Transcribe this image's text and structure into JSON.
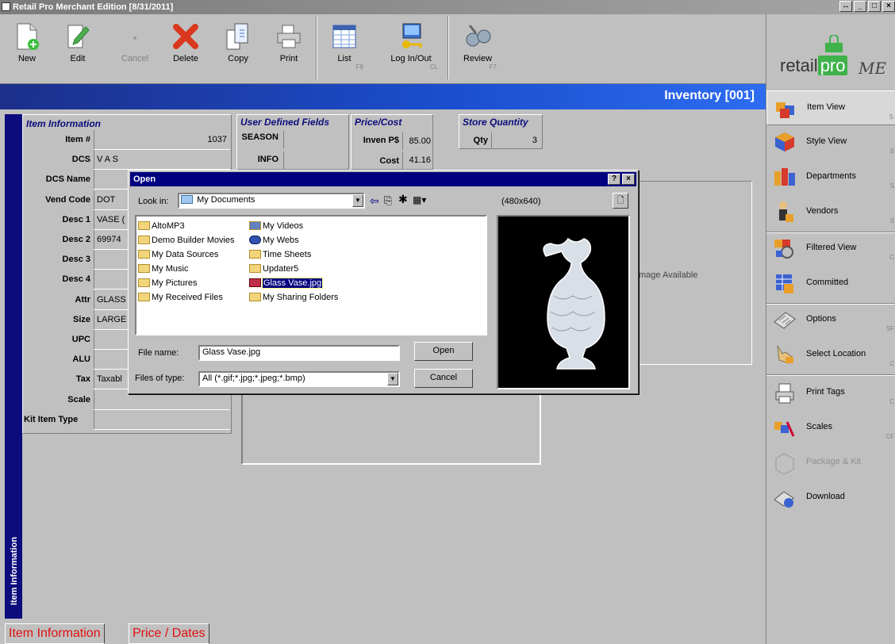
{
  "window": {
    "title": "Retail Pro Merchant Edition [8/31/2011]",
    "controls": [
      "↔",
      "_",
      "□",
      "×"
    ]
  },
  "toolbar": [
    {
      "label": "New",
      "key": ""
    },
    {
      "label": "Edit",
      "key": ""
    },
    {
      "label": "Cancel",
      "key": ""
    },
    {
      "label": "Delete",
      "key": ""
    },
    {
      "label": "Copy",
      "key": ""
    },
    {
      "label": "Print",
      "key": ""
    },
    {
      "label": "List",
      "key": "F8"
    },
    {
      "label": "Log In/Out",
      "key": "CL"
    },
    {
      "label": "Review",
      "key": "F7"
    }
  ],
  "logo": {
    "text1": "retail",
    "text2": "pro",
    "text3": "ME"
  },
  "header": {
    "title": "Inventory [001]"
  },
  "right_panel": [
    {
      "label": "Item View",
      "key": "S"
    },
    {
      "label": "Style View",
      "key": "S"
    },
    {
      "label": "Departments",
      "key": "S"
    },
    {
      "label": "Vendors",
      "key": "S"
    },
    {
      "label": "Filtered View",
      "key": "C"
    },
    {
      "label": "Committed",
      "key": ""
    },
    {
      "label": "Options",
      "key": "SF"
    },
    {
      "label": "Select Location",
      "key": "C"
    },
    {
      "label": "Print Tags",
      "key": "C"
    },
    {
      "label": "Scales",
      "key": "CF"
    },
    {
      "label": "Package & Kit",
      "key": ""
    },
    {
      "label": "Download",
      "key": ""
    }
  ],
  "left_tab": "Item Information",
  "item_info": {
    "title": "Item Information",
    "fields": [
      {
        "label": "Item #",
        "value": "1037"
      },
      {
        "label": "DCS",
        "value": "V A S"
      },
      {
        "label": "DCS Name",
        "value": ""
      },
      {
        "label": "Vend Code",
        "value": "DOT"
      },
      {
        "label": "Desc 1",
        "value": "VASE ("
      },
      {
        "label": "Desc 2",
        "value": "69974"
      },
      {
        "label": "Desc 3",
        "value": ""
      },
      {
        "label": "Desc 4",
        "value": ""
      },
      {
        "label": "Attr",
        "value": "GLASS"
      },
      {
        "label": "Size",
        "value": "LARGE"
      },
      {
        "label": "UPC",
        "value": ""
      },
      {
        "label": "ALU",
        "value": ""
      },
      {
        "label": "Tax",
        "value": "Taxabl"
      },
      {
        "label": "Scale",
        "value": ""
      },
      {
        "label": "Kit Item Type",
        "value": ""
      }
    ]
  },
  "udf": {
    "title": "User Defined Fields",
    "rows": [
      {
        "label": "SEASON",
        "value": ""
      },
      {
        "label": "INFO",
        "value": ""
      }
    ]
  },
  "price": {
    "title": "Price/Cost",
    "rows": [
      {
        "label": "Inven P$",
        "value": "85.00"
      },
      {
        "label": "Cost",
        "value": "41.16"
      }
    ]
  },
  "store_qty": {
    "title": "Store Quantity",
    "label": "Qty",
    "value": "3"
  },
  "image_area": {
    "text": "mage Available"
  },
  "open_dialog": {
    "title": "Open",
    "help": "?",
    "close": "×",
    "look_in_label": "Look in:",
    "look_in_value": "My Documents",
    "preview_size": "(480x640)",
    "files_col1": [
      "AltoMP3",
      "Demo Builder Movies",
      "My Data Sources",
      "My Music",
      "My Pictures",
      "My Received Files"
    ],
    "files_col2": [
      "My Videos",
      "My Webs",
      "Time Sheets",
      "Updater5",
      "Glass Vase.jpg",
      "My Sharing Folders"
    ],
    "file_name_label": "File name:",
    "file_name_value": "Glass Vase.jpg",
    "files_of_type_label": "Files of type:",
    "files_of_type_value": "All (*.gif;*.jpg;*.jpeg;*.bmp)",
    "open_button": "Open",
    "cancel_button": "Cancel"
  },
  "bottom_tabs": [
    "Item Information",
    "Price / Dates"
  ]
}
